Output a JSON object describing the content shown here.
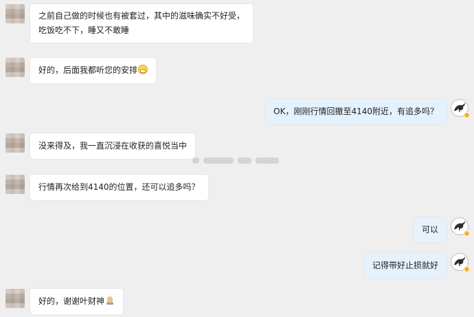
{
  "messages": [
    {
      "side": "left",
      "text_line1": "之前自己做的时候也有被套过，其中的滋味确实不好受，",
      "text_line2": "吃饭吃不下，睡又不敢睡"
    },
    {
      "side": "left",
      "text": "好的，后面我都听您的安排",
      "emoji": "grinning-face"
    },
    {
      "side": "right",
      "text": "OK，刚刚行情回撤至4140附近，有追多吗？"
    },
    {
      "side": "left",
      "text": "没来得及，我一直沉浸在收获的喜悦当中"
    },
    {
      "side": "left",
      "text": "行情再次给到4140的位置，还可以追多吗？"
    },
    {
      "side": "right",
      "text": "可以"
    },
    {
      "side": "right",
      "text": "记得带好止损就好"
    },
    {
      "side": "left",
      "text": "好的，谢谢叶财神",
      "emoji": "folded-hands"
    }
  ],
  "colors": {
    "background": "#efefef",
    "left_bubble": "#ffffff",
    "right_bubble": "#e5f1fb",
    "avatar_badge": "#f2b51f"
  },
  "icons": {
    "left_avatar": "blurred-avatar",
    "right_avatar": "horse-logo-avatar",
    "badge": "verified-badge-icon"
  }
}
